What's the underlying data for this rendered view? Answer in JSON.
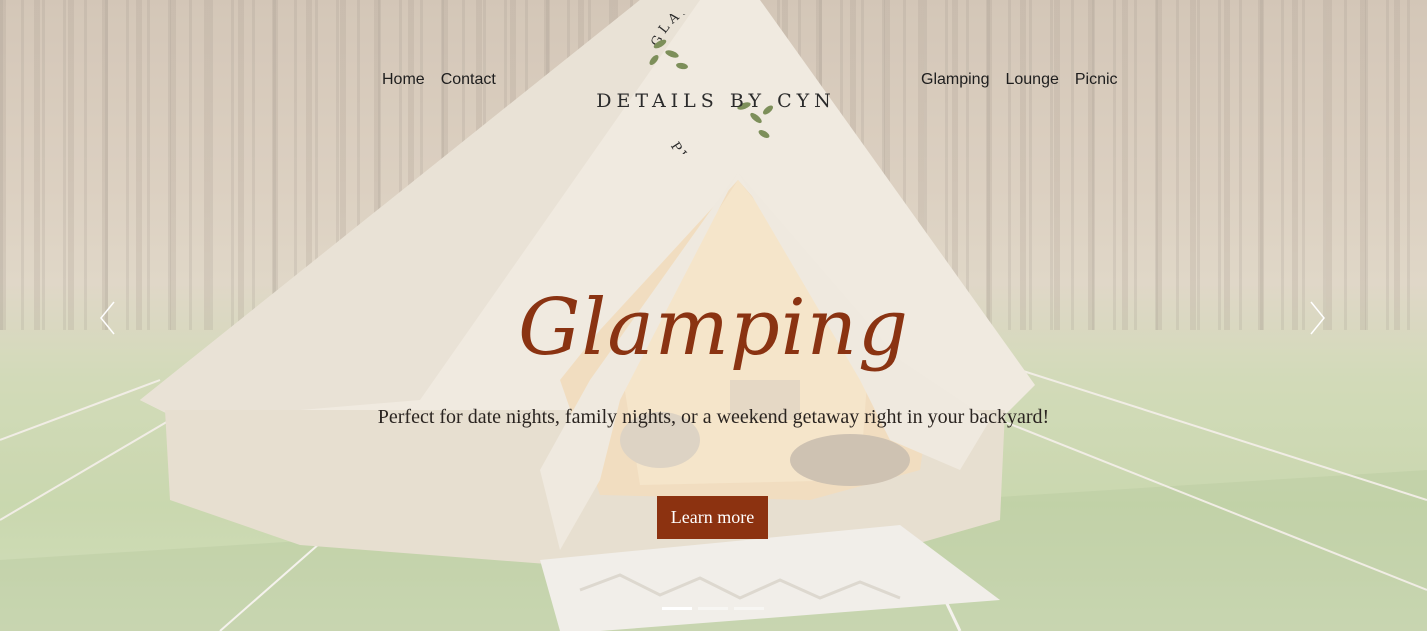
{
  "nav": {
    "left": [
      {
        "label": "Home"
      },
      {
        "label": "Contact"
      }
    ],
    "right": [
      {
        "label": "Glamping"
      },
      {
        "label": "Lounge"
      },
      {
        "label": "Picnic"
      }
    ]
  },
  "logo": {
    "top_arc": "GLAMPING",
    "main": "DETAILS BY CYN",
    "bottom_arc": "PICNICS"
  },
  "hero": {
    "headline": "Glamping",
    "subline": "Perfect for date nights, family nights, or a weekend getaway right in your backyard!",
    "cta_label": "Learn more"
  },
  "slider": {
    "arrows": [
      "chevron-left-icon",
      "chevron-right-icon"
    ],
    "slide_count": 3,
    "active_slide": 1
  },
  "colors": {
    "accent": "#8c3210",
    "headline": "#8a3312",
    "nav_text": "#1e1e1e"
  }
}
